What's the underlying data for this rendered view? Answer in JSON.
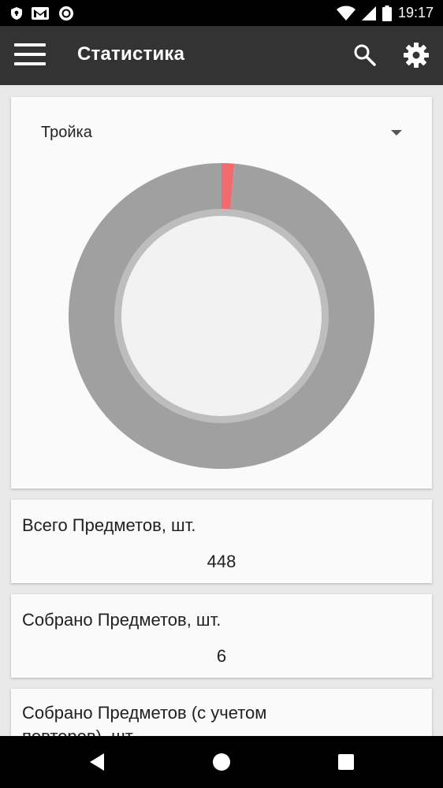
{
  "status_bar": {
    "time": "19:17",
    "icons": [
      "shield-notification-icon",
      "gmail-icon",
      "record-icon",
      "wifi-icon",
      "cellular-signal-icon",
      "battery-icon"
    ]
  },
  "app_bar": {
    "title": "Статистика",
    "icons": [
      "menu-icon",
      "search-icon",
      "settings-gear-icon"
    ]
  },
  "chart_card": {
    "selected_option": "Тройка"
  },
  "chart_data": {
    "type": "pie",
    "labels": [
      "",
      ""
    ],
    "values": [
      6,
      442
    ],
    "colors": [
      "#f06a6e",
      "#a0a0a0"
    ]
  },
  "stats": [
    {
      "label": "Всего Предметов, шт.",
      "value": "448"
    },
    {
      "label": "Собрано Предметов, шт.",
      "value": "6"
    },
    {
      "label": "Собрано Предметов (с учетом повторов), шт.",
      "value": ""
    }
  ],
  "colors": {
    "app_bar": "#333333",
    "background": "#e9e9e9",
    "card": "#fafafa",
    "accent_slice": "#f06a6e",
    "remaining_slice": "#a0a0a0"
  },
  "nav_bar": {
    "icons": [
      "back-icon",
      "home-icon",
      "recents-icon"
    ]
  }
}
